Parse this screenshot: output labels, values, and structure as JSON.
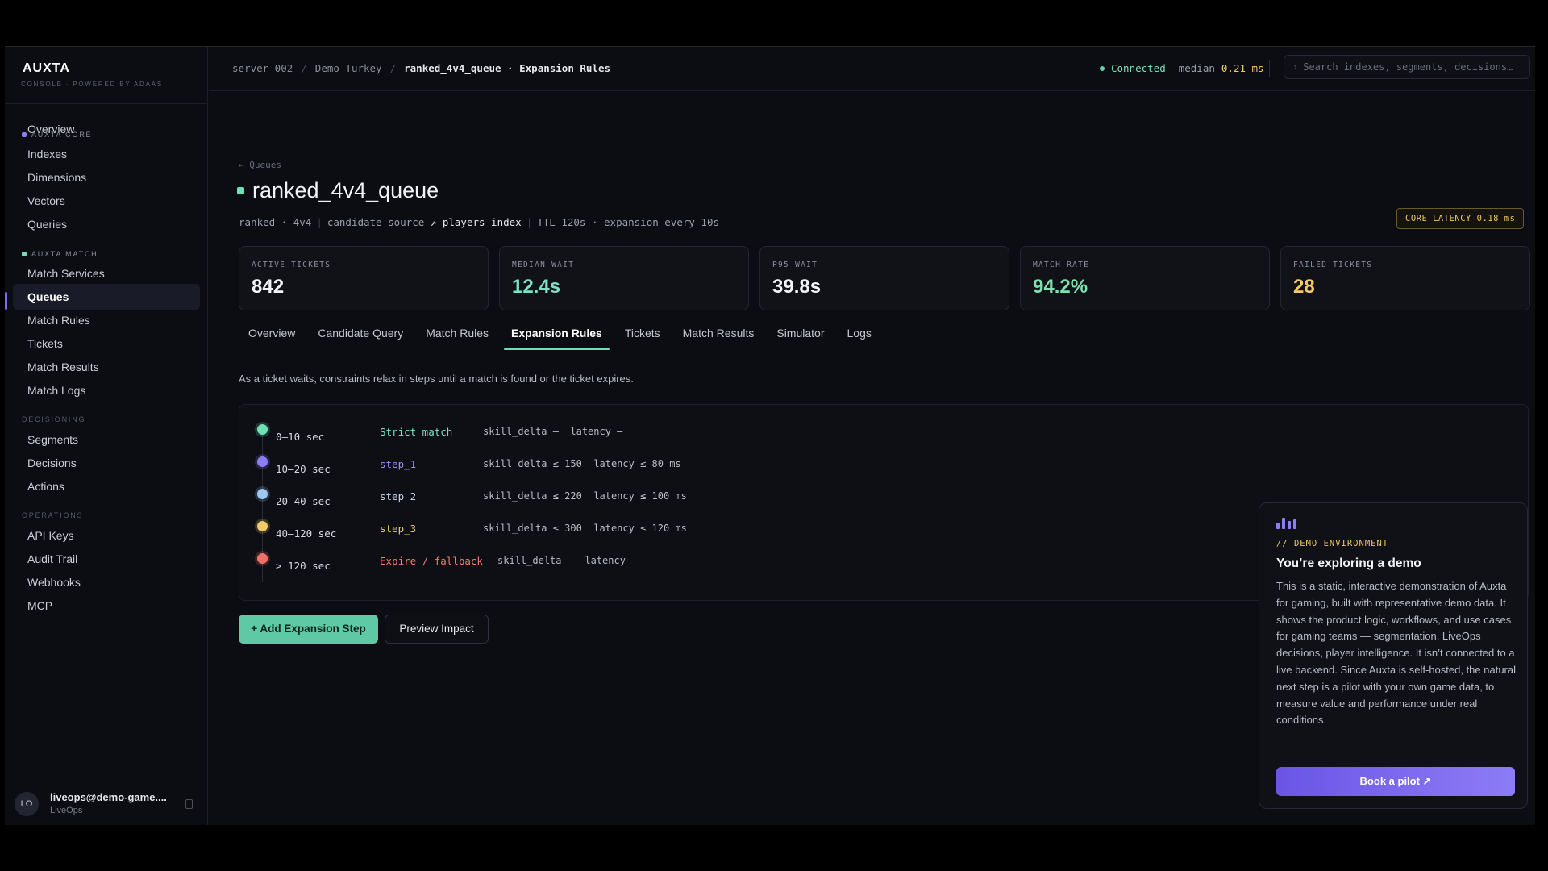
{
  "app": {
    "logo": "AUXTA",
    "logo_sub": "CONSOLE · POWERED BY ADAAS"
  },
  "sidebar": {
    "top_item": "Overview",
    "sections": [
      {
        "title": "AUXTA CORE",
        "color": "#8c7cf5",
        "items": [
          "Indexes",
          "Dimensions",
          "Vectors",
          "Queries"
        ]
      },
      {
        "title": "AUXTA MATCH",
        "color": "#6fe0b4",
        "items": [
          "Match Services",
          "Queues",
          "Match Rules",
          "Tickets",
          "Match Results",
          "Match Logs"
        ]
      },
      {
        "title": "DECISIONING",
        "items": [
          "Segments",
          "Decisions",
          "Actions"
        ]
      },
      {
        "title": "OPERATIONS",
        "items": [
          "API Keys",
          "Audit Trail",
          "Webhooks",
          "MCP"
        ]
      }
    ],
    "active_item": "Queues",
    "user": {
      "initials": "LO",
      "email": "liveops@demo-game....",
      "role": "LiveOps"
    }
  },
  "topbar": {
    "breadcrumbs": [
      "server-002",
      "Demo Turkey",
      "ranked_4v4_queue · Expansion Rules"
    ],
    "connection": "Connected",
    "median_label": "median",
    "median_value": "0.21 ms",
    "search_placeholder": "Search indexes, segments, decisions…"
  },
  "queue": {
    "back_link": "← Queues",
    "name": "ranked_4v4_queue",
    "meta": {
      "mode": "ranked",
      "format": "4v4",
      "candidate_label": "candidate source",
      "candidate_value": "↗ players index",
      "ttl": "TTL 120s",
      "expansion": "expansion every 10s"
    },
    "latency_badge": "CORE LATENCY 0.18 ms"
  },
  "stats": [
    {
      "label": "ACTIVE TICKETS",
      "value": "842",
      "color": "#f2f3f7"
    },
    {
      "label": "MEDIAN WAIT",
      "value": "12.4s",
      "color": "#7fe0c4"
    },
    {
      "label": "P95 WAIT",
      "value": "39.8s",
      "color": "#f2f3f7"
    },
    {
      "label": "MATCH RATE",
      "value": "94.2%",
      "color": "#7fe0b0"
    },
    {
      "label": "FAILED TICKETS",
      "value": "28",
      "color": "#f4c96a"
    }
  ],
  "tabs": [
    "Overview",
    "Candidate Query",
    "Match Rules",
    "Expansion Rules",
    "Tickets",
    "Match Results",
    "Simulator",
    "Logs"
  ],
  "active_tab": "Expansion Rules",
  "description": "As a ticket waits, constraints relax in steps until a match is found or the ticket expires.",
  "steps": [
    {
      "time": "0–10 sec",
      "name": "Strict match",
      "params": "skill_delta —  latency —",
      "color": "#6fe0b4",
      "name_color": "#7fe0c4"
    },
    {
      "time": "10–20 sec",
      "name": "step_1",
      "params": "skill_delta ≤ 150  latency ≤ 80 ms",
      "color": "#8c7cf5",
      "name_color": "#9d8ef7"
    },
    {
      "time": "20–40 sec",
      "name": "step_2",
      "params": "skill_delta ≤ 220  latency ≤ 100 ms",
      "color": "#9cc8f5",
      "name_color": "#c8d3ea"
    },
    {
      "time": "40–120 sec",
      "name": "step_3",
      "params": "skill_delta ≤ 300  latency ≤ 120 ms",
      "color": "#f4c96a",
      "name_color": "#f4c96a"
    },
    {
      "time": "> 120 sec",
      "name": "Expire / fallback",
      "params": "skill_delta —  latency —",
      "color": "#f07068",
      "name_color": "#f07c70"
    }
  ],
  "buttons": {
    "add_step": "+ Add Expansion Step",
    "preview": "Preview Impact"
  },
  "demo": {
    "kicker": "// DEMO ENVIRONMENT",
    "title": "You’re exploring a demo",
    "body": "This is a static, interactive demonstration of Auxta for gaming, built with representative demo data. It shows the product logic, workflows, and use cases for gaming teams — segmentation, LiveOps decisions, player intelligence. It isn’t connected to a live backend. Since Auxta is self-hosted, the natural next step is a pilot with your own game data, to measure value and performance under real conditions.",
    "cta": "Book a pilot ↗"
  }
}
